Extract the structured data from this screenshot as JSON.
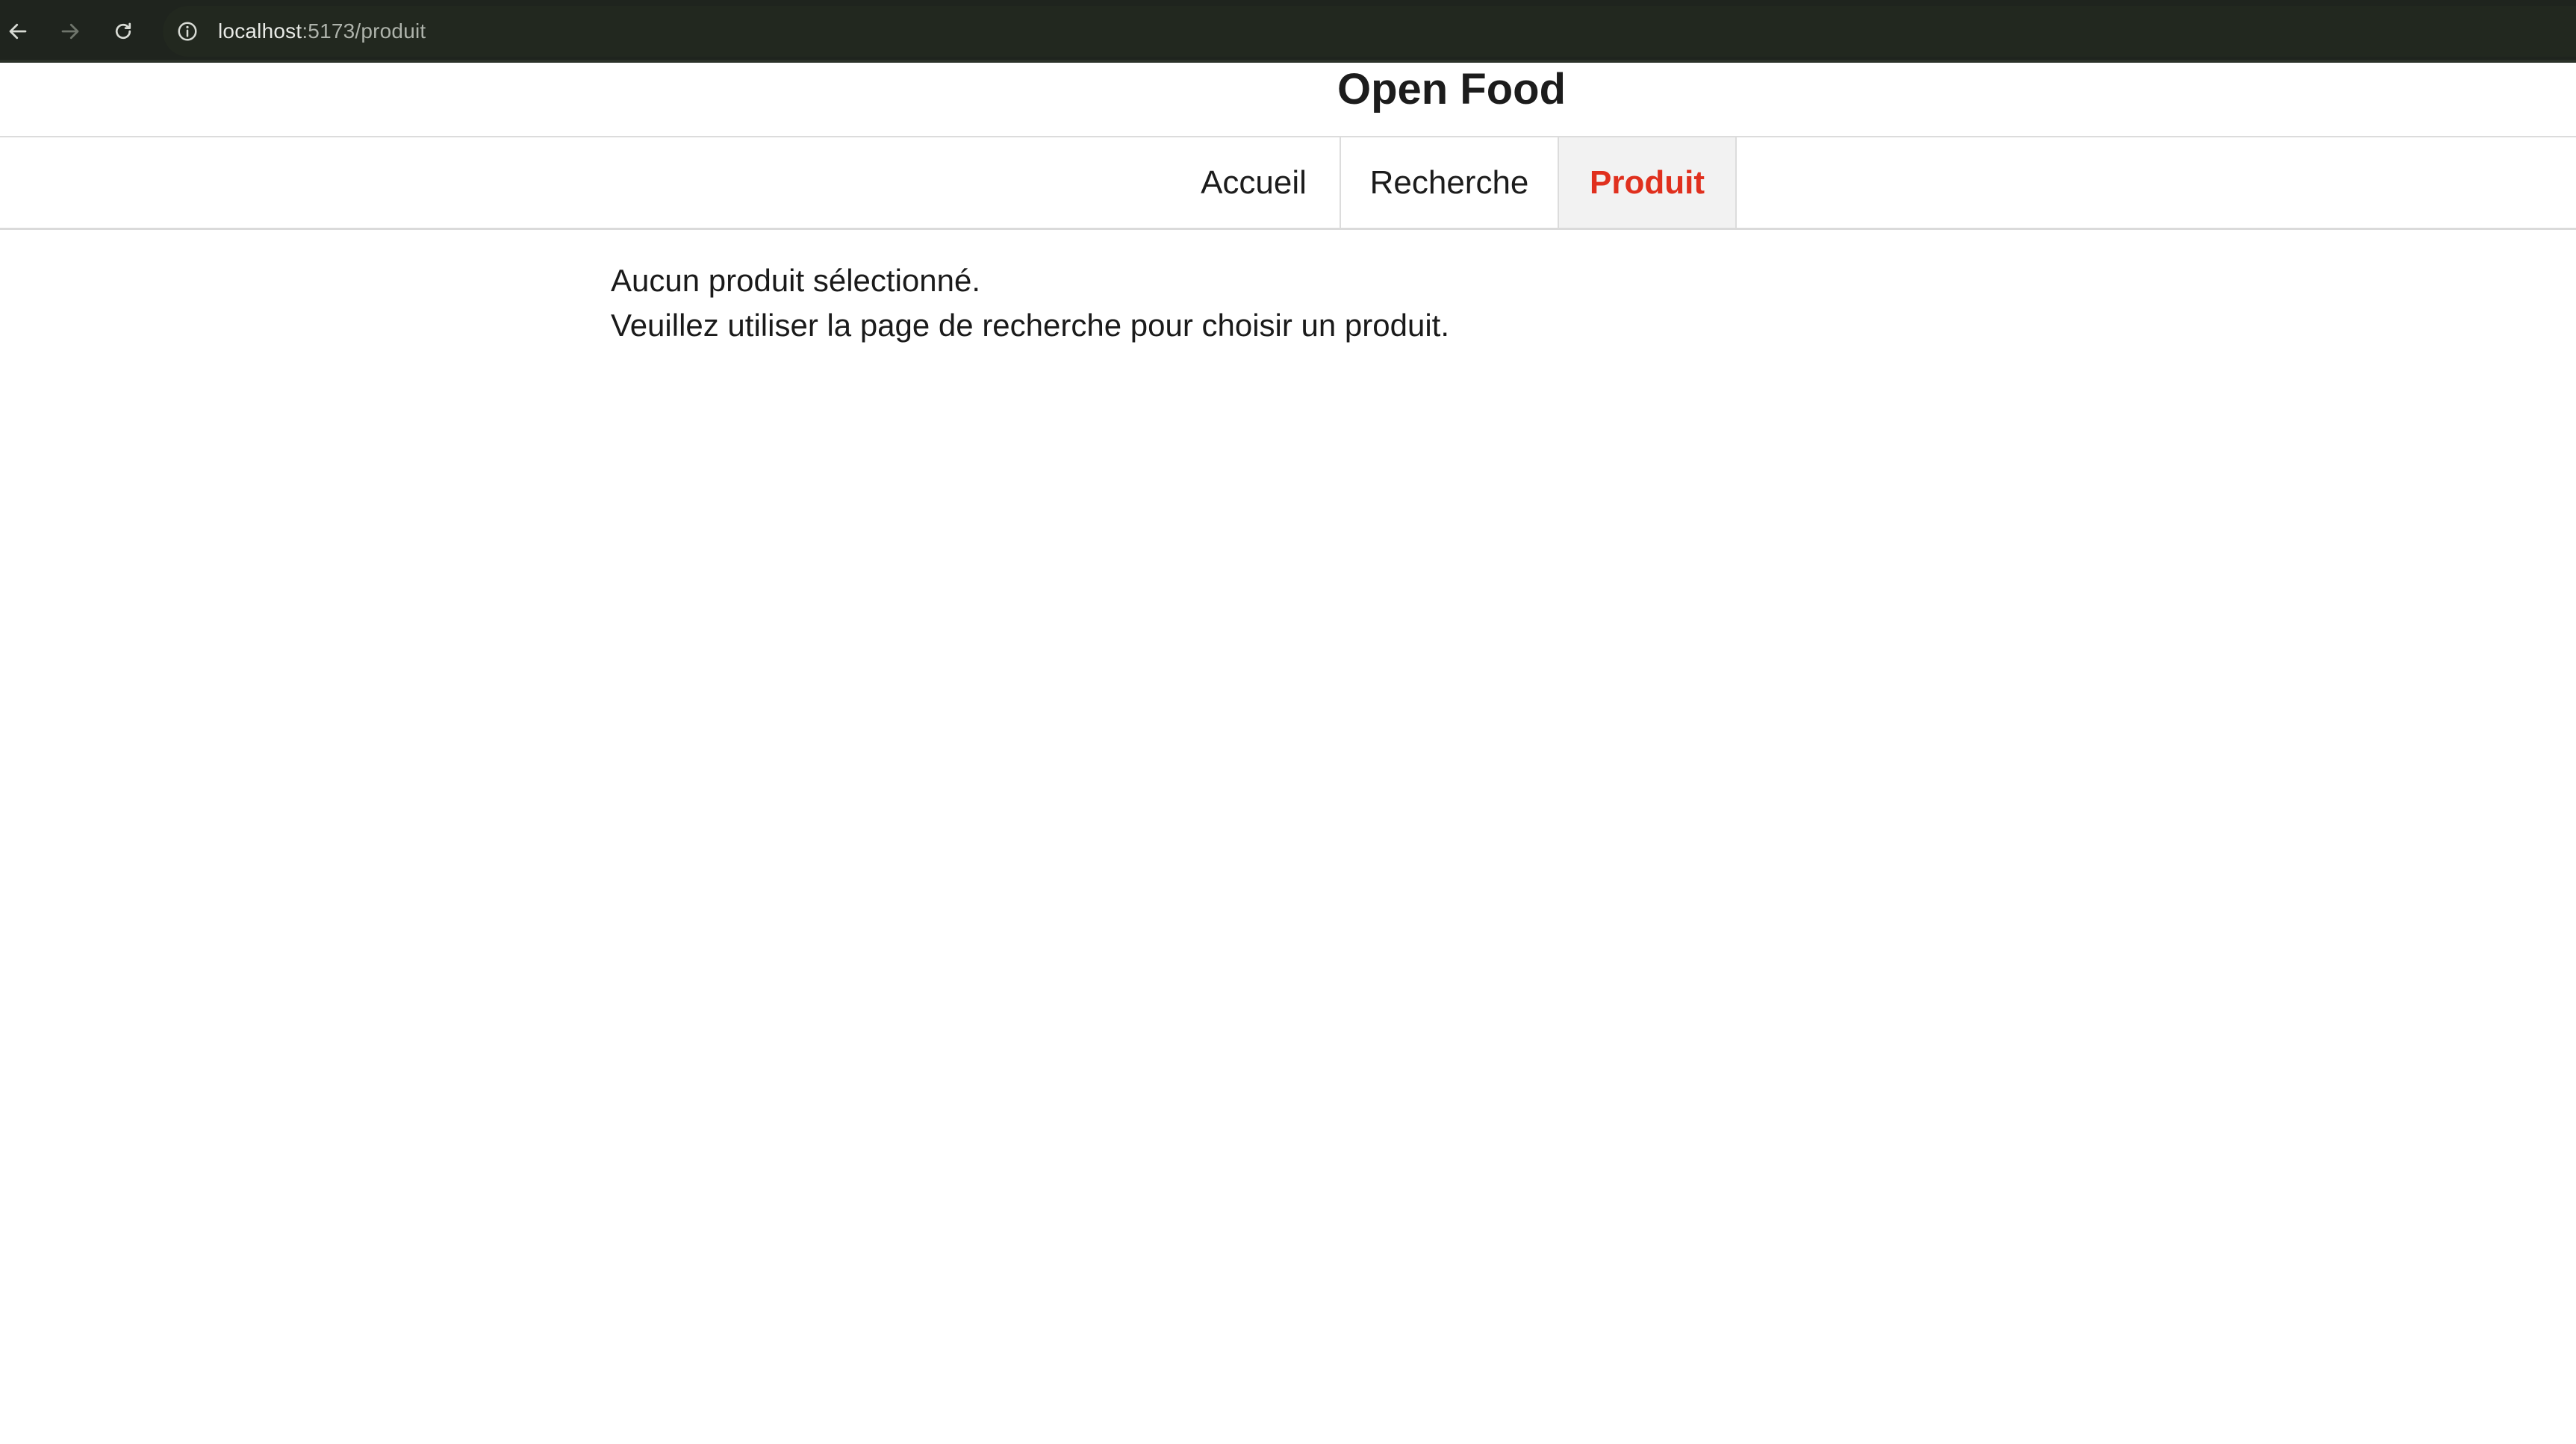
{
  "browser": {
    "url_host": "localhost",
    "url_path": ":5173/produit",
    "back_icon": "arrow-left-icon",
    "forward_icon": "arrow-right-icon",
    "reload_icon": "reload-icon",
    "site_info_icon": "info-icon"
  },
  "header": {
    "title": "Open Food"
  },
  "nav": {
    "tabs": [
      {
        "label": "Accueil",
        "active": false
      },
      {
        "label": "Recherche",
        "active": false
      },
      {
        "label": "Produit",
        "active": true
      }
    ],
    "active_color": "#e0301e"
  },
  "main": {
    "line1": "Aucun produit sélectionné.",
    "line2": "Veuillez utiliser la page de recherche pour choisir un produit."
  }
}
